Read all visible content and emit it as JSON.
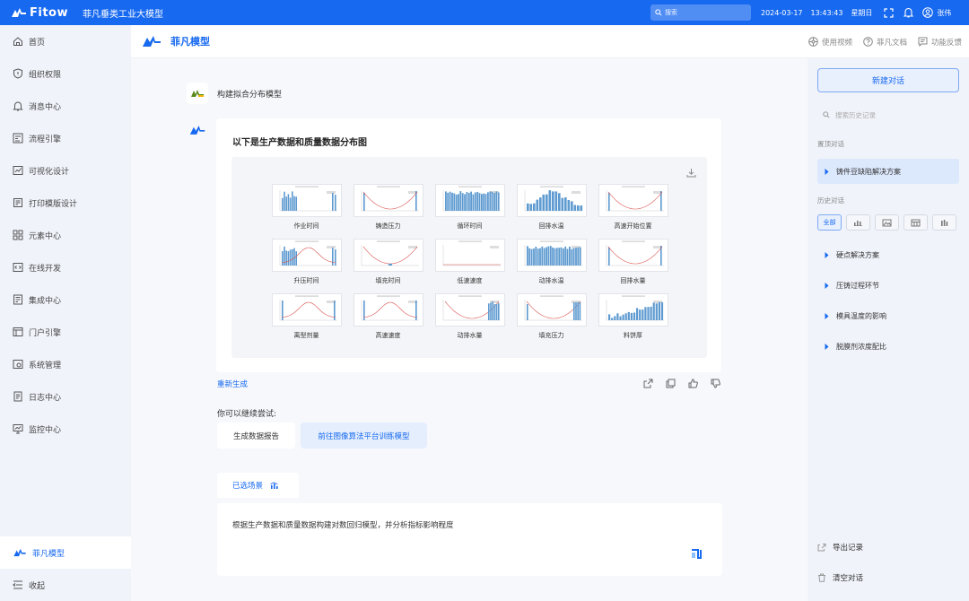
{
  "topbar": {
    "logo_text": "Fitow",
    "app_title": "菲凡垂类工业大模型",
    "search_placeholder": "搜索",
    "date": "2024-03-17",
    "time": "13:43:43",
    "weekday": "星期日",
    "user_name": "张伟",
    "bg_color": "#1769f0"
  },
  "sidebar": {
    "items": [
      {
        "label": "首页",
        "icon": "home-icon"
      },
      {
        "label": "组织权限",
        "icon": "shield-icon"
      },
      {
        "label": "消息中心",
        "icon": "bell-icon"
      },
      {
        "label": "流程引擎",
        "icon": "flow-icon"
      },
      {
        "label": "可视化设计",
        "icon": "chart-icon"
      },
      {
        "label": "打印模版设计",
        "icon": "printer-icon"
      },
      {
        "label": "元素中心",
        "icon": "grid-icon"
      },
      {
        "label": "在线开发",
        "icon": "code-icon"
      },
      {
        "label": "集成中心",
        "icon": "integration-icon"
      },
      {
        "label": "门户引擎",
        "icon": "portal-icon"
      },
      {
        "label": "系统管理",
        "icon": "settings-icon"
      },
      {
        "label": "日志中心",
        "icon": "log-icon"
      },
      {
        "label": "监控中心",
        "icon": "monitor-icon"
      }
    ],
    "active_item": "菲凡模型",
    "collapse_label": "收起"
  },
  "header": {
    "title": "菲凡模型",
    "links": [
      {
        "label": "使用视频",
        "icon": "video-icon"
      },
      {
        "label": "菲凡文档",
        "icon": "help-icon"
      },
      {
        "label": "功能反馈",
        "icon": "feedback-icon"
      }
    ]
  },
  "chat": {
    "user_message": "构建拟合分布模型",
    "ai_title": "以下是生产数据和质量数据分布图",
    "charts": [
      {
        "label": "作业时间",
        "kind": "bars-left"
      },
      {
        "label": "铸造压力",
        "kind": "curve"
      },
      {
        "label": "循环时间",
        "kind": "bars-full"
      },
      {
        "label": "回排水温",
        "kind": "histogram"
      },
      {
        "label": "高速开始位置",
        "kind": "curve"
      },
      {
        "label": "升压时间",
        "kind": "bars-left-curve"
      },
      {
        "label": "填充时间",
        "kind": "curve-low"
      },
      {
        "label": "低速速度",
        "kind": "flat"
      },
      {
        "label": "动排水温",
        "kind": "bars-full"
      },
      {
        "label": "回排水量",
        "kind": "curve"
      },
      {
        "label": "离型剂量",
        "kind": "bars-edge"
      },
      {
        "label": "高速速度",
        "kind": "bars-edge"
      },
      {
        "label": "动排水量",
        "kind": "bars-right"
      },
      {
        "label": "填充压力",
        "kind": "curve-bars"
      },
      {
        "label": "料饼厚",
        "kind": "histogram-right"
      }
    ],
    "regenerate_label": "重新生成",
    "try_label": "你可以继续尝试:",
    "suggestions": [
      "生成数据报告",
      "前往图像算法平台训练模型"
    ],
    "scene_tab_label": "已选场景",
    "input_text": "根据生产数据和质量数据构建对数回归模型，并分析指标影响程度"
  },
  "history": {
    "new_chat_label": "新建对话",
    "search_placeholder": "搜索历史记录",
    "pinned_label": "置顶对话",
    "pinned_item": "铸件豆缺陷解决方案",
    "history_label": "历史对话",
    "filter_all": "全部",
    "items": [
      "硬点解决方案",
      "压铸过程环节",
      "模具温度的影响",
      "脱膜剂浓度配比"
    ],
    "export_label": "导出记录",
    "clear_label": "清空对话"
  }
}
